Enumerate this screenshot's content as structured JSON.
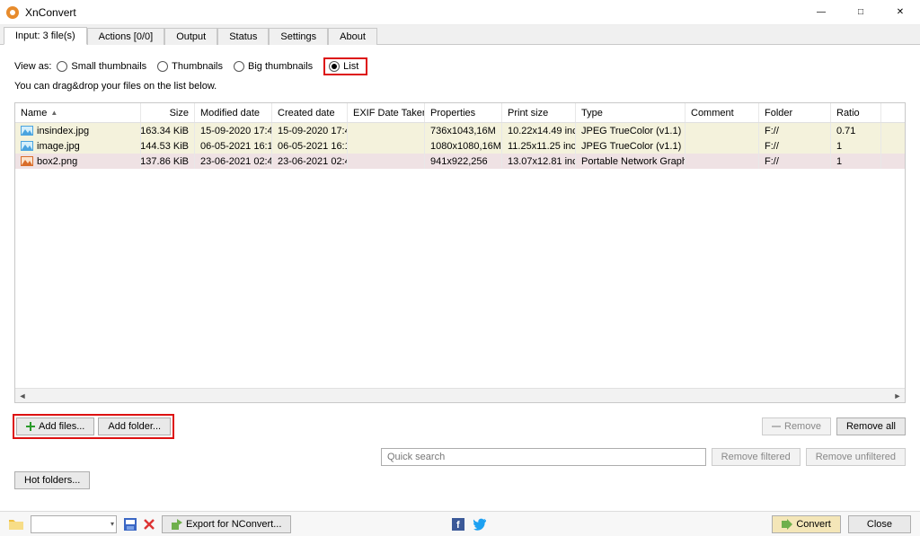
{
  "app": {
    "title": "XnConvert"
  },
  "tabs": {
    "input": "Input: 3 file(s)",
    "actions": "Actions [0/0]",
    "output": "Output",
    "status": "Status",
    "settings": "Settings",
    "about": "About"
  },
  "viewas": {
    "label": "View as:",
    "small": "Small thumbnails",
    "thumb": "Thumbnails",
    "big": "Big thumbnails",
    "list": "List",
    "hint": "You can drag&drop your files on the list below."
  },
  "columns": {
    "name": "Name",
    "size": "Size",
    "modified": "Modified date",
    "created": "Created date",
    "exif": "EXIF Date Taken",
    "properties": "Properties",
    "print": "Print size",
    "type": "Type",
    "comment": "Comment",
    "folder": "Folder",
    "ratio": "Ratio"
  },
  "rows": [
    {
      "name": "insindex.jpg",
      "size": "163.34 KiB",
      "modified": "15-09-2020 17:4...",
      "created": "15-09-2020 17:4...",
      "exif": "",
      "properties": "736x1043,16M",
      "print": "10.22x14.49 inc...",
      "type": "JPEG TrueColor (v1.1)",
      "comment": "",
      "folder": "F://",
      "ratio": "0.71"
    },
    {
      "name": "image.jpg",
      "size": "144.53 KiB",
      "modified": "06-05-2021 16:1...",
      "created": "06-05-2021 16:1...",
      "exif": "",
      "properties": "1080x1080,16M",
      "print": "11.25x11.25 inc...",
      "type": "JPEG TrueColor (v1.1)",
      "comment": "",
      "folder": "F://",
      "ratio": "1"
    },
    {
      "name": "box2.png",
      "size": "137.86 KiB",
      "modified": "23-06-2021 02:4...",
      "created": "23-06-2021 02:4...",
      "exif": "",
      "properties": "941x922,256",
      "print": "13.07x12.81 inc...",
      "type": "Portable Network Graphics",
      "comment": "",
      "folder": "F://",
      "ratio": "1"
    }
  ],
  "buttons": {
    "add_files": "Add files...",
    "add_folder": "Add folder...",
    "remove": "Remove",
    "remove_all": "Remove all",
    "hot_folders": "Hot folders...",
    "remove_filtered": "Remove filtered",
    "remove_unfiltered": "Remove unfiltered",
    "export": "Export for NConvert...",
    "convert": "Convert",
    "close": "Close"
  },
  "search": {
    "placeholder": "Quick search"
  }
}
